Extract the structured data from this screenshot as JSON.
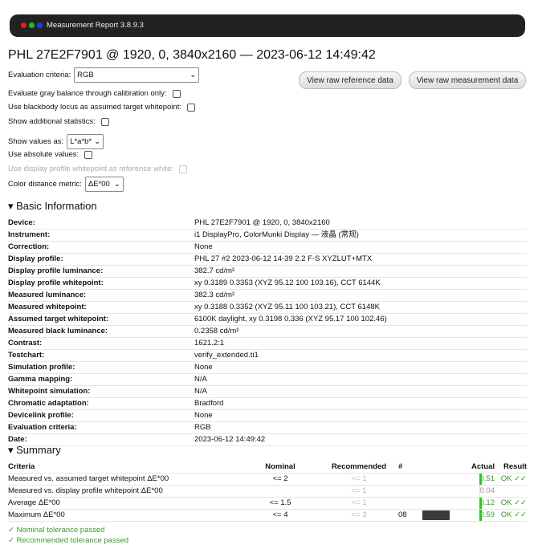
{
  "window": {
    "title": "Measurement Report 3.8.9.3",
    "dots": [
      "#e02020",
      "#20c020",
      "#2040e0"
    ]
  },
  "page_title": "PHL 27E2F7901 @ 1920, 0, 3840x2160 — 2023-06-12 14:49:42",
  "options": {
    "evaluation_criteria_label": "Evaluation criteria:",
    "evaluation_criteria_value": "RGB",
    "gray_balance_label": "Evaluate gray balance through calibration only:",
    "blackbody_label": "Use blackbody locus as assumed target whitepoint:",
    "additional_stats_label": "Show additional statistics:",
    "show_values_label": "Show values as:",
    "show_values_value": "L*a*b*",
    "absolute_label": "Use absolute values:",
    "profile_wp_label": "Use display profile whitepoint as reference white:",
    "metric_label": "Color distance metric:",
    "metric_value": "ΔE*00"
  },
  "buttons": {
    "ref": "View raw reference data",
    "meas": "View raw measurement data"
  },
  "basic": {
    "title": "Basic Information",
    "rows": [
      [
        "Device:",
        "PHL 27E2F7901 @ 1920, 0, 3840x2160"
      ],
      [
        "Instrument:",
        "i1 DisplayPro, ColorMunki Display — 液晶 (常规)"
      ],
      [
        "Correction:",
        "None"
      ],
      [
        "Display profile:",
        "PHL 27 #2 2023-06-12 14-39 2.2 F-S XYZLUT+MTX"
      ],
      [
        "Display profile luminance:",
        "382.7 cd/m²"
      ],
      [
        "Display profile whitepoint:",
        "xy 0.3189 0.3353 (XYZ 95.12 100 103.16), CCT 6144K"
      ],
      [
        "Measured luminance:",
        "382.3 cd/m²"
      ],
      [
        "Measured whitepoint:",
        "xy 0.3188 0.3352 (XYZ 95.11 100 103.21), CCT 6148K"
      ],
      [
        "Assumed target whitepoint:",
        "6100K daylight, xy 0.3198 0.336 (XYZ 95.17 100 102.46)"
      ],
      [
        "Measured black luminance:",
        "0.2358 cd/m²"
      ],
      [
        "Contrast:",
        "1621.2:1"
      ],
      [
        "Testchart:",
        "verify_extended.ti1"
      ],
      [
        "Simulation profile:",
        "None"
      ],
      [
        "Gamma mapping:",
        "N/A"
      ],
      [
        "Whitepoint simulation:",
        "N/A"
      ],
      [
        "Chromatic adaptation:",
        "Bradford"
      ],
      [
        "Devicelink profile:",
        "None"
      ],
      [
        "Evaluation criteria:",
        "RGB"
      ],
      [
        "Date:",
        "2023-06-12 14:49:42"
      ]
    ]
  },
  "summary": {
    "title": "Summary",
    "headers": [
      "Criteria",
      "Nominal",
      "Recommended",
      "#",
      "Actual",
      "Result"
    ],
    "rows": [
      {
        "criteria": "Measured vs. assumed target whitepoint ΔE*00",
        "nominal": "<= 2",
        "recommended": "<= 1",
        "num": "",
        "actual": "0.51",
        "result": "OK ✓✓",
        "bar": "#22cc22"
      },
      {
        "criteria": "Measured vs. display profile whitepoint ΔE*00",
        "nominal": "",
        "recommended": "<= 1",
        "num": "",
        "actual": "0.04",
        "result": "",
        "bar": ""
      },
      {
        "criteria": "Average ΔE*00",
        "nominal": "<= 1.5",
        "recommended": "<= 1",
        "num": "",
        "actual": "0.12",
        "result": "OK ✓✓",
        "bar": "#22cc22"
      },
      {
        "criteria": "Maximum ΔE*00",
        "nominal": "<= 4",
        "recommended": "<= 3",
        "num": "08",
        "actual": "0.59",
        "result": "OK ✓✓",
        "bar": "#22cc22",
        "swatch": "#3a3a3a"
      }
    ],
    "passed": [
      "✓ Nominal tolerance passed",
      "✓ Recommended tolerance passed"
    ]
  }
}
